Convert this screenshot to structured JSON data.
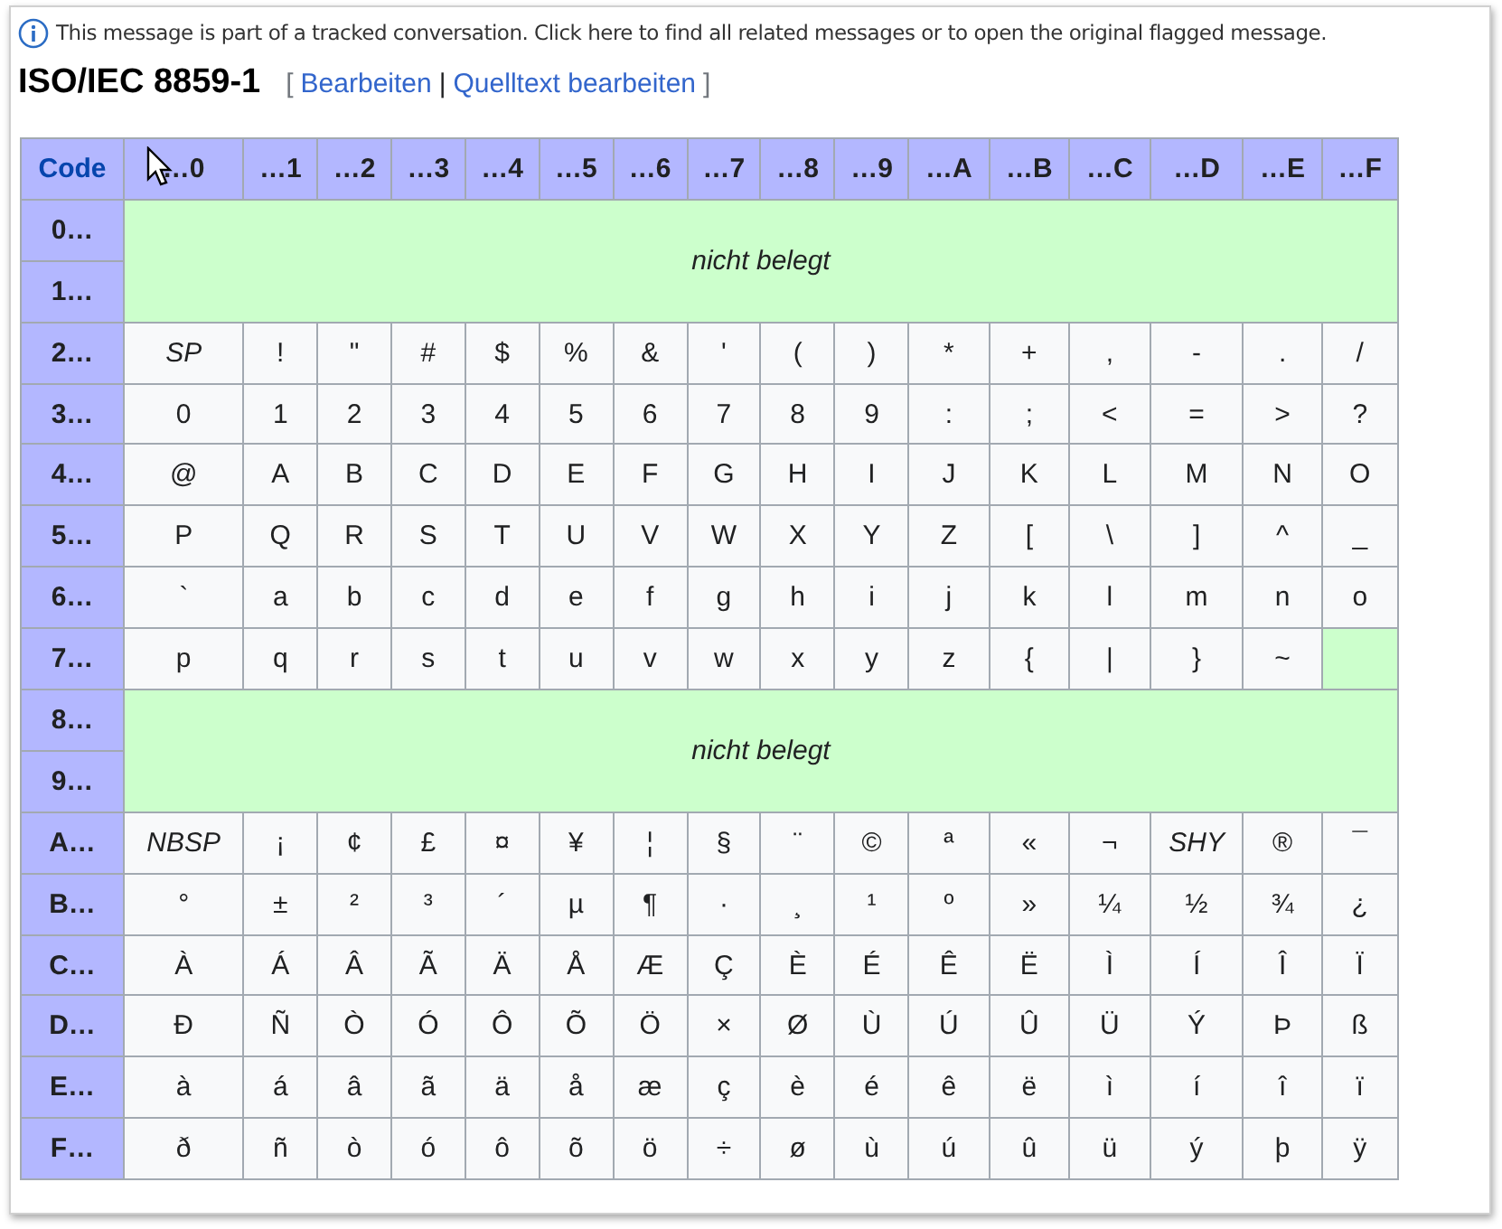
{
  "banner": {
    "text": "This message is part of a tracked conversation. Click here to find all related messages or to open the original flagged message."
  },
  "heading": {
    "title": "ISO/IEC 8859-1",
    "open": "[",
    "links": [
      "Bearbeiten",
      "Quelltext bearbeiten"
    ],
    "separator": "|",
    "close": "]"
  },
  "table": {
    "corner": "Code",
    "columns": [
      "…0",
      "…1",
      "…2",
      "…3",
      "…4",
      "…5",
      "…6",
      "…7",
      "…8",
      "…9",
      "…A",
      "…B",
      "…C",
      "…D",
      "…E",
      "…F"
    ],
    "rows": [
      {
        "kind": "unassigned",
        "codes": [
          "0…",
          "1…"
        ],
        "label": "nicht belegt"
      },
      {
        "kind": "chars",
        "code": "2…",
        "cells": [
          {
            "kind": "name",
            "text": "SP"
          },
          "!",
          "\"",
          "#",
          "$",
          "%",
          "&",
          "'",
          "(",
          ")",
          "*",
          "+",
          ",",
          "-",
          ".",
          "/"
        ]
      },
      {
        "kind": "chars",
        "code": "3…",
        "cells": [
          "0",
          "1",
          "2",
          "3",
          "4",
          "5",
          "6",
          "7",
          "8",
          "9",
          ":",
          ";",
          "<",
          "=",
          ">",
          "?"
        ]
      },
      {
        "kind": "chars",
        "code": "4…",
        "cells": [
          "@",
          "A",
          "B",
          "C",
          "D",
          "E",
          "F",
          "G",
          "H",
          "I",
          "J",
          "K",
          "L",
          "M",
          "N",
          "O"
        ]
      },
      {
        "kind": "chars",
        "code": "5…",
        "cells": [
          "P",
          "Q",
          "R",
          "S",
          "T",
          "U",
          "V",
          "W",
          "X",
          "Y",
          "Z",
          "[",
          "\\",
          "]",
          "^",
          "_"
        ]
      },
      {
        "kind": "chars",
        "code": "6…",
        "cells": [
          "`",
          "a",
          "b",
          "c",
          "d",
          "e",
          "f",
          "g",
          "h",
          "i",
          "j",
          "k",
          "l",
          "m",
          "n",
          "o"
        ]
      },
      {
        "kind": "chars",
        "code": "7…",
        "cells": [
          "p",
          "q",
          "r",
          "s",
          "t",
          "u",
          "v",
          "w",
          "x",
          "y",
          "z",
          "{",
          "|",
          "}",
          "~",
          {
            "kind": "unassigned"
          }
        ]
      },
      {
        "kind": "unassigned",
        "codes": [
          "8…",
          "9…"
        ],
        "label": "nicht belegt"
      },
      {
        "kind": "chars",
        "code": "A…",
        "cells": [
          {
            "kind": "name",
            "text": "NBSP"
          },
          "¡",
          "¢",
          "£",
          "¤",
          "¥",
          "¦",
          "§",
          "¨",
          "©",
          "ª",
          "«",
          "¬",
          {
            "kind": "name",
            "text": "SHY"
          },
          "®",
          "¯"
        ]
      },
      {
        "kind": "chars",
        "code": "B…",
        "cells": [
          "°",
          "±",
          "²",
          "³",
          "´",
          "µ",
          "¶",
          "·",
          "¸",
          "¹",
          "º",
          "»",
          "¼",
          "½",
          "¾",
          "¿"
        ]
      },
      {
        "kind": "chars",
        "code": "C…",
        "cells": [
          "À",
          "Á",
          "Â",
          "Ã",
          "Ä",
          "Å",
          "Æ",
          "Ç",
          "È",
          "É",
          "Ê",
          "Ë",
          "Ì",
          "Í",
          "Î",
          "Ï"
        ]
      },
      {
        "kind": "chars",
        "code": "D…",
        "cells": [
          "Ð",
          "Ñ",
          "Ò",
          "Ó",
          "Ô",
          "Õ",
          "Ö",
          "×",
          "Ø",
          "Ù",
          "Ú",
          "Û",
          "Ü",
          "Ý",
          "Þ",
          "ß"
        ]
      },
      {
        "kind": "chars",
        "code": "E…",
        "cells": [
          "à",
          "á",
          "â",
          "ã",
          "ä",
          "å",
          "æ",
          "ç",
          "è",
          "é",
          "ê",
          "ë",
          "ì",
          "í",
          "î",
          "ï"
        ]
      },
      {
        "kind": "chars",
        "code": "F…",
        "cells": [
          "ð",
          "ñ",
          "ò",
          "ó",
          "ô",
          "õ",
          "ö",
          "÷",
          "ø",
          "ù",
          "ú",
          "û",
          "ü",
          "ý",
          "þ",
          "ÿ"
        ]
      }
    ]
  }
}
